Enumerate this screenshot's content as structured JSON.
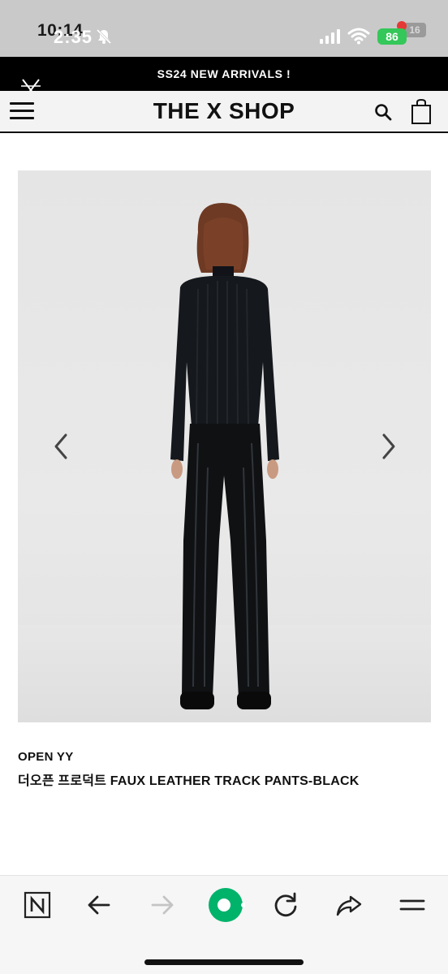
{
  "status_bar": {
    "time": "2:35",
    "ghost_time": "10:14",
    "battery": "86",
    "ghost_battery": "16"
  },
  "announcement": {
    "text": "SS24 NEW ARRIVALS !"
  },
  "header": {
    "title": "THE X SHOP",
    "menu_icon": "hamburger-menu-icon",
    "search_icon": "search-icon",
    "bag_icon": "shopping-bag-icon"
  },
  "product": {
    "brand": "OPEN YY",
    "name": "더오픈 프로덕트 FAUX LEATHER TRACK PANTS-BLACK",
    "image_description_icon": "model-back-view-image"
  },
  "browser_bar": {
    "buttons": [
      {
        "icon": "naver-n-icon"
      },
      {
        "icon": "back-arrow-icon"
      },
      {
        "icon": "forward-arrow-icon"
      },
      {
        "icon": "green-dot-home-icon"
      },
      {
        "icon": "refresh-icon"
      },
      {
        "icon": "share-icon"
      },
      {
        "icon": "menu-lines-icon"
      }
    ]
  },
  "colors": {
    "banner_bg": "#000000",
    "accent_green": "#00b36b",
    "battery_green": "#34c759",
    "header_bg": "#f3f3f3"
  }
}
